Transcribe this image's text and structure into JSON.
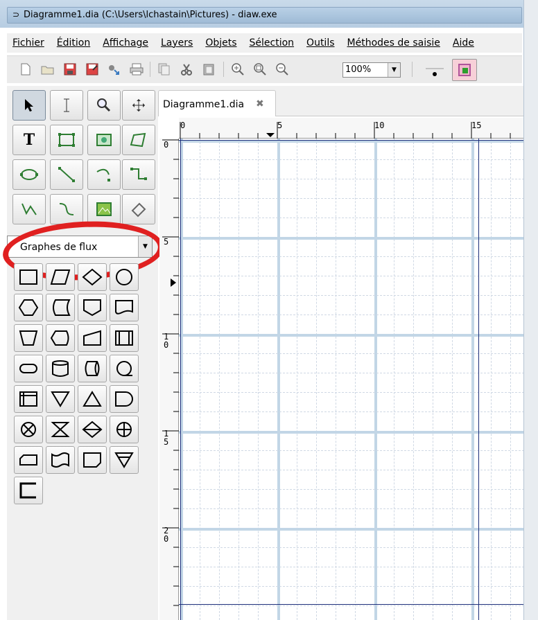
{
  "window": {
    "title": "Diagramme1.dia (C:\\Users\\lchastain\\Pictures) - diaw.exe"
  },
  "menu": [
    "Fichier",
    "Édition",
    "Affichage",
    "Layers",
    "Objets",
    "Sélection",
    "Outils",
    "Méthodes de saisie",
    "Aide"
  ],
  "toolbar": {
    "icons": [
      "new-icon",
      "open-icon",
      "save-icon",
      "save-as-icon",
      "export-icon",
      "print-icon",
      "copy-icon",
      "cut-icon",
      "paste-icon",
      "zoom-in-icon",
      "zoom-fit-icon",
      "zoom-out-icon"
    ],
    "zoom": "100%"
  },
  "toolbox": {
    "tools": [
      "select-tool",
      "text-edit-tool",
      "magnify-tool",
      "scroll-tool",
      "text-tool",
      "box-tool",
      "image-tool",
      "polygon-tool",
      "ellipse-tool",
      "line-tool",
      "arc-tool",
      "zigzag-tool",
      "polyline-tool",
      "bezier-tool",
      "outline-tool",
      "beziergon-tool"
    ],
    "sheet": "Graphes de flux"
  },
  "tab": {
    "label": "Diagramme1.dia"
  },
  "ruler": {
    "top": [
      "0",
      "5",
      "10",
      "15"
    ],
    "left": [
      "0",
      "5",
      "1\n0",
      "1\n5",
      "2\n0"
    ]
  }
}
